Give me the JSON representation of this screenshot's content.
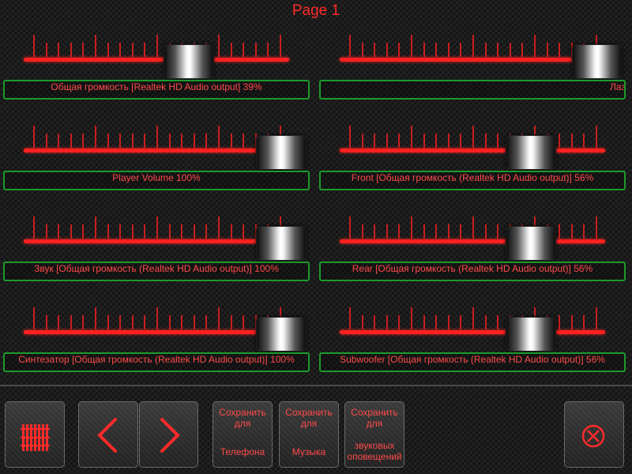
{
  "page_title": "Page 1",
  "sliders": [
    {
      "label": "Общая громкость [Realtek HD Audio output] 39%",
      "value_percent": 39
    },
    {
      "label": "Лаз",
      "value_percent": 100,
      "label_overflow": true
    },
    {
      "label": "Player Volume 100%",
      "value_percent": 100
    },
    {
      "label": "Front [Общая громкость (Realtek HD Audio output)] 56%",
      "value_percent": 56
    },
    {
      "label": "Звук [Общая громкость (Realtek HD Audio output)] 100%",
      "value_percent": 100
    },
    {
      "label": "Rear [Общая громкость (Realtek HD Audio output)] 56%",
      "value_percent": 56
    },
    {
      "label": "Синтезатор [Общая громкость (Realtek HD Audio output)] 100%",
      "value_percent": 100
    },
    {
      "label": "Subwoofer [Общая громкость (Realtek HD Audio output)] 56%",
      "value_percent": 56
    }
  ],
  "buttons": {
    "equalizer_icon": "equalizer-icon",
    "prev_icon": "chevron-left-icon",
    "next_icon": "chevron-right-icon",
    "save_phone": {
      "line1": "Сохранить",
      "line2": "для",
      "line3": "Телефона"
    },
    "save_music": {
      "line1": "Сохранить",
      "line2": "для",
      "line3": "Музыка"
    },
    "save_alerts": {
      "line1": "Сохранить",
      "line2": "для",
      "line3": "звуковых",
      "line4": "оповещений"
    },
    "close_icon": "close-circle-icon"
  },
  "colors": {
    "accent": "#ff2020",
    "label_border": "#1c9a2c",
    "text": "#ff4a4a"
  }
}
